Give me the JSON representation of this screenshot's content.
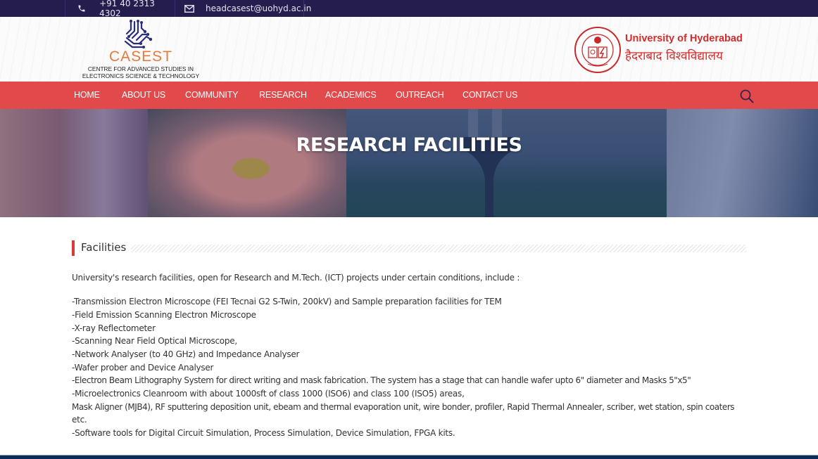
{
  "topbar": {
    "phone": "+91 40 2313 4302",
    "phone_icon": "phone-icon",
    "email": "headcasest@uohyd.ac.in",
    "email_icon": "envelope-icon"
  },
  "header": {
    "logo": {
      "wordmark": "CASEST",
      "tagline_line1": "CENTRE FOR ADVANCED STUDIES IN",
      "tagline_line2": "ELECTRONICS SCIENCE & TECHNOLOGY"
    },
    "university": {
      "name_en": "University of Hyderabad",
      "name_hi": "हैदराबाद विश्वविद्यालय"
    }
  },
  "nav": {
    "items": [
      {
        "label": "HOME"
      },
      {
        "label": "ABOUT US"
      },
      {
        "label": "COMMUNITY"
      },
      {
        "label": "RESEARCH"
      },
      {
        "label": "ACADEMICS"
      },
      {
        "label": "OUTREACH"
      },
      {
        "label": "CONTACT US"
      }
    ],
    "search_icon": "search-icon"
  },
  "banner": {
    "title": "RESEARCH FACILITIES"
  },
  "section": {
    "heading": "Facilities",
    "intro": "University's research facilities, open for Research and M.Tech. (ICT) projects under certain conditions, include :",
    "items": [
      "-Transmission Electron Microscope (FEI Tecnai G2 S-Twin, 200kV) and Sample preparation facilities for TEM",
      "-Field Emission Scanning Electron Microscope",
      "-X-ray Reflectometer",
      "-Scanning Near Field Optical Microscope,",
      "-Network Analyser (to 40 GHz) and Impedance Analyser",
      "-Wafer prober and Device Analyser",
      "-Electron Beam Lithography System for direct writing and mask fabrication. The system has a stage that can handle wafer upto 6\" diameter and Masks 5\"x5\"",
      "-Microelectronics Cleanroom with about 1000sft of class 1000 (ISO6) and class 100 (ISO5) areas,",
      "Mask Aligner (MJB4), RF sputtering deposition unit, ebeam and thermal evaporation unit, wire bonder, profiler, Rapid Thermal Annealer, scriber, wet station, spin coaters",
      "etc.",
      "-Software tools for Digital Circuit Simulation, Process Simulation, Device Simulation, FPGA kits."
    ]
  },
  "colors": {
    "topbar_bg": "#251d4e",
    "nav_bg": "#e2494b",
    "accent_red": "#d63a3a",
    "logo_orange": "#e37a3c",
    "logo_navy": "#2b2f7a",
    "footer_navy": "#0c2b55"
  }
}
